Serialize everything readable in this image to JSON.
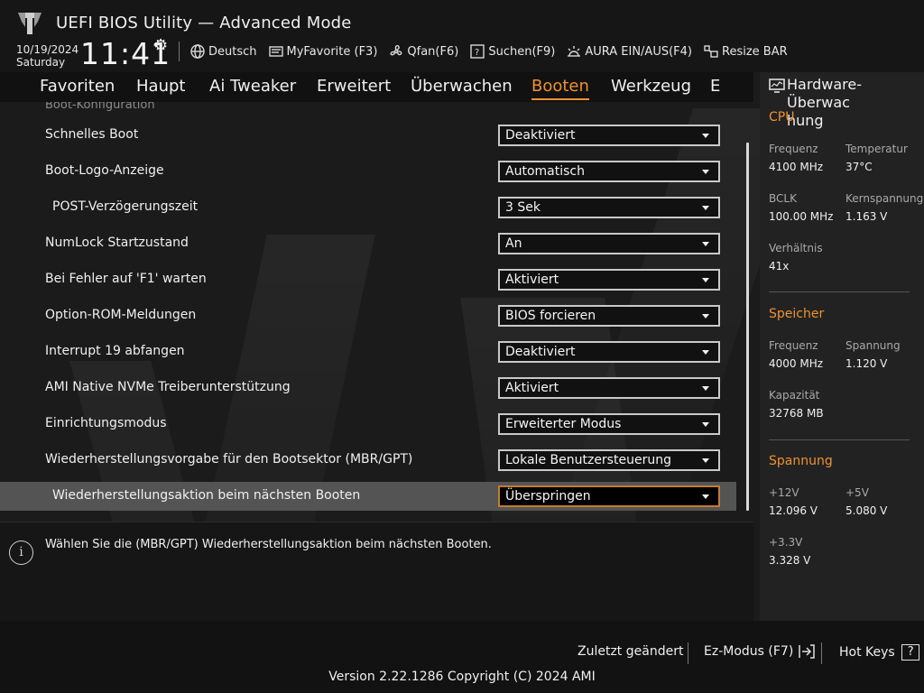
{
  "header": {
    "title": "UEFI BIOS Utility — Advanced Mode",
    "date": "10/19/2024",
    "day": "Saturday",
    "time": "11:41",
    "toolbar": [
      {
        "label": "Deutsch",
        "icon": "globe-icon"
      },
      {
        "label": "MyFavorite (F3)",
        "icon": "favorite-icon"
      },
      {
        "label": "Qfan(F6)",
        "icon": "fan-icon"
      },
      {
        "label": "Suchen(F9)",
        "icon": "search-icon"
      },
      {
        "label": "AURA EIN/AUS(F4)",
        "icon": "aura-icon"
      },
      {
        "label": "Resize BAR",
        "icon": "resize-bar-icon"
      }
    ]
  },
  "nav": {
    "tabs": [
      "Favoriten",
      "Haupt",
      "Ai Tweaker",
      "Erweitert",
      "Überwachen",
      "Booten",
      "Werkzeug",
      "E"
    ],
    "active": "Booten"
  },
  "settings": {
    "section_title": "Boot-Konfiguration",
    "rows": [
      {
        "label": "Schnelles Boot",
        "value": "Deaktiviert",
        "indent": false
      },
      {
        "label": "Boot-Logo-Anzeige",
        "value": "Automatisch",
        "indent": false
      },
      {
        "label": "POST-Verzögerungszeit",
        "value": "3 Sek",
        "indent": true
      },
      {
        "label": "NumLock Startzustand",
        "value": "An",
        "indent": false
      },
      {
        "label": "Bei Fehler auf 'F1' warten",
        "value": "Aktiviert",
        "indent": false
      },
      {
        "label": "Option-ROM-Meldungen",
        "value": "BIOS forcieren",
        "indent": false
      },
      {
        "label": "Interrupt 19 abfangen",
        "value": "Deaktiviert",
        "indent": false
      },
      {
        "label": "AMI Native NVMe Treiberunterstützung",
        "value": "Aktiviert",
        "indent": false
      },
      {
        "label": "Einrichtungsmodus",
        "value": "Erweiterter Modus",
        "indent": false
      },
      {
        "label": "Wiederherstellungsvorgabe für den Bootsektor (MBR/GPT)",
        "value": "Lokale Benutzersteuerung",
        "indent": false
      },
      {
        "label": "Wiederherstellungsaktion beim nächsten Booten",
        "value": "Überspringen",
        "indent": true,
        "selected": true
      }
    ]
  },
  "help": {
    "icon": "info-icon",
    "text": "Wählen Sie die (MBR/GPT) Wiederherstellungsaktion beim nächsten Booten."
  },
  "hardware": {
    "title": "Hardware-Überwachung",
    "title_line1": "Hardware-Überwac",
    "title_line2": "hung",
    "cpu": {
      "heading": "CPU",
      "freq_label": "Frequenz",
      "freq": "4100 MHz",
      "temp_label": "Temperatur",
      "temp": "37°C",
      "bclk_label": "BCLK",
      "bclk": "100.00 MHz",
      "vcore_label": "Kernspannung",
      "vcore": "1.163 V",
      "ratio_label": "Verhältnis",
      "ratio": "41x"
    },
    "memory": {
      "heading": "Speicher",
      "freq_label": "Frequenz",
      "freq": "4000 MHz",
      "volt_label": "Spannung",
      "volt": "1.120 V",
      "cap_label": "Kapazität",
      "cap": "32768 MB"
    },
    "voltage": {
      "heading": "Spannung",
      "v12_label": "+12V",
      "v12": "12.096 V",
      "v5_label": "+5V",
      "v5": "5.080 V",
      "v33_label": "+3.3V",
      "v33": "3.328 V"
    }
  },
  "footer": {
    "last_changed": "Zuletzt geändert",
    "ez_mode": "Ez-Modus (F7)",
    "hot_keys": "Hot Keys",
    "hot_keys_box": "?",
    "version": "Version 2.22.1286 Copyright (C) 2024 AMI"
  },
  "colors": {
    "accent": "#f0922f",
    "background": "#1b1b1b",
    "selected_row": "#545454"
  }
}
